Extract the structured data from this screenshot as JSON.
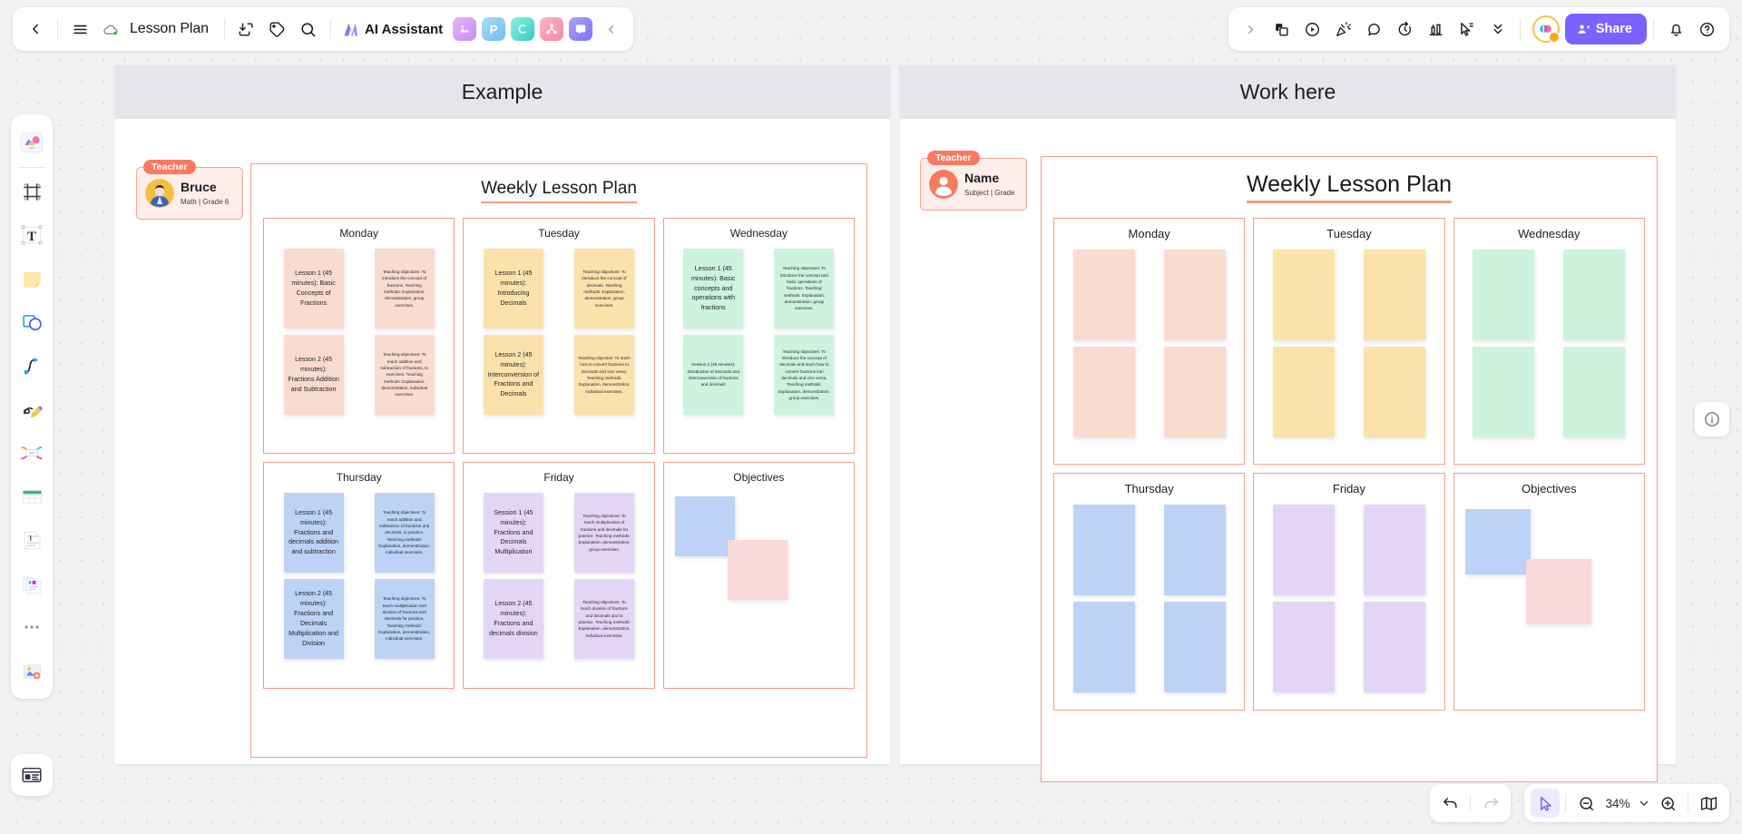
{
  "topbar": {
    "back_icon": "chevron-left-icon",
    "menu_icon": "hamburger-menu-icon",
    "cloud_icon": "cloud-sync-icon",
    "doc_title": "Lesson Plan",
    "download_icon": "download-icon",
    "tag_icon": "tag-icon",
    "search_icon": "search-icon",
    "ai_label": "AI Assistant",
    "apps": [
      {
        "name": "image-app",
        "glyph": "◩",
        "color": "#d6a6f5"
      },
      {
        "name": "presentation-app",
        "glyph": "P",
        "color": "#7fc4f5"
      },
      {
        "name": "mindmap-app",
        "glyph": "ᴄ",
        "color": "#3fd0c9"
      },
      {
        "name": "flowchart-app",
        "glyph": "Ѧ",
        "color": "#f58fae"
      },
      {
        "name": "comment-app",
        "glyph": "▣",
        "color": "#8e7bf7"
      }
    ],
    "collapse_icon": "chevron-left-icon",
    "expand_icon": "chevron-right-icon",
    "right_tools": [
      {
        "name": "sticky-note-icon"
      },
      {
        "name": "play-circle-icon"
      },
      {
        "name": "celebrate-icon"
      },
      {
        "name": "comment-bubble-icon"
      },
      {
        "name": "timer-icon"
      },
      {
        "name": "vote-chart-icon"
      },
      {
        "name": "cursor-select-icon"
      },
      {
        "name": "chevrons-down-icon"
      }
    ],
    "avatar_name": "user-avatar",
    "share_label": "Share",
    "bell_icon": "notification-bell-icon",
    "help_icon": "help-circle-icon"
  },
  "left_toolbar": {
    "items": [
      {
        "name": "templates-tool"
      },
      {
        "name": "frame-tool"
      },
      {
        "name": "text-tool"
      },
      {
        "name": "sticky-note-tool"
      },
      {
        "name": "shapes-tool"
      },
      {
        "name": "connector-tool"
      },
      {
        "name": "pen-tool"
      },
      {
        "name": "mindmap-tool"
      },
      {
        "name": "table-tool"
      },
      {
        "name": "document-tool"
      },
      {
        "name": "slides-tool"
      },
      {
        "name": "more-tools"
      },
      {
        "name": "upload-tool"
      }
    ],
    "bottom_tool": "presentation-mode-tool",
    "info_tool": "info-icon"
  },
  "bottombar": {
    "undo_icon": "undo-icon",
    "redo_icon": "redo-icon",
    "cursor_icon": "cursor-pointer-icon",
    "zoom_out_icon": "zoom-out-icon",
    "zoom_level": "34%",
    "zoom_dropdown_icon": "chevron-down-icon",
    "zoom_in_icon": "zoom-in-icon",
    "minimap_icon": "minimap-icon"
  },
  "boards": [
    {
      "name": "example-board",
      "header_title": "Example",
      "teacher": {
        "badge": "Teacher",
        "name": "Bruce",
        "subject": "Math | Grade 6"
      },
      "plan_title": "Weekly Lesson Plan",
      "days": [
        {
          "title": "Monday",
          "color": "#fadbd0",
          "notes": [
            {
              "type": "lesson",
              "text": "Lesson 1 (45 minutes): Basic Concepts of Fractions"
            },
            {
              "type": "detail",
              "text": "Teaching objectives: To introduce the concept of fractions. Teaching methods: Explanation, demonstration, group exercises."
            },
            {
              "type": "lesson",
              "text": "Lesson 2 (45 minutes): Fractions Addition and Subtraction"
            },
            {
              "type": "detail",
              "text": "Teaching objectives: To teach addition and subtraction of fractions, to exercises. Teaching methods: Explanation, demonstration, individual exercises."
            }
          ]
        },
        {
          "title": "Tuesday",
          "color": "#fbe2ab",
          "notes": [
            {
              "type": "lesson",
              "text": "Lesson 1 (45 minutes): Introducing Decimals"
            },
            {
              "type": "detail",
              "text": "Teaching objectives: To introduce the concept of decimals. Teaching methods: Explanation, demonstration, group exercises."
            },
            {
              "type": "lesson",
              "text": "Lesson 2 (45 minutes): Interconversion of Fractions and Decimals"
            },
            {
              "type": "detail",
              "text": "Teaching objective: To teach how to convert fractions to decimals and vice versa. Teaching methods: Explanation, demonstration, individual exercises."
            }
          ]
        },
        {
          "title": "Wednesday",
          "color": "#cdf2dd",
          "notes": [
            {
              "type": "lesson",
              "text": "Lesson 1 (45 minutes): Basic concepts and operations with fractions"
            },
            {
              "type": "detail",
              "text": "Teaching objectives: To introduce the concept and basic operations of fractions. Teaching methods: Explanation, demonstration, group exercises."
            },
            {
              "type": "detail",
              "text": "Session 2 (45 minutes): Introduction of decimals and interconversion of fractions and decimals"
            },
            {
              "type": "detail",
              "text": "Teaching objectives: To introduce the concept of decimals and teach how to convert fractions into decimals and vice versa. Teaching methods: Explanation, demonstration, group exercises."
            }
          ]
        },
        {
          "title": "Thursday",
          "color": "#bcd2f7",
          "notes": [
            {
              "type": "lesson",
              "text": "Lesson 1 (45 minutes): Fractions and decimals addition and subtraction"
            },
            {
              "type": "detail",
              "text": "Teaching objectives: To teach addition and subtraction of fractions and decimals, to practice. Teaching methods: Explanation, demonstration, individual exercises."
            },
            {
              "type": "lesson",
              "text": "Lesson 2 (45 minutes): Fractions and Decimals Multiplication and Division"
            },
            {
              "type": "detail",
              "text": "Teaching objectives: To teach multiplication and division of fractions and decimals for practice. Teaching methods: Explanation, demonstration, individual exercises."
            }
          ]
        },
        {
          "title": "Friday",
          "color": "#e4d5f7",
          "notes": [
            {
              "type": "lesson",
              "text": "Session 1 (45 minutes): Fractions and Decimals Multiplication"
            },
            {
              "type": "detail",
              "text": "Teaching objectives: To teach multiplication of fractions and decimals for practice. Teaching methods: Explanation, demonstration, group exercises."
            },
            {
              "type": "lesson",
              "text": "Lesson 2 (45 minutes): Fractions and decimals division"
            },
            {
              "type": "detail",
              "text": "Teaching objectives: To teach division of fractions and decimals and to practice. Teaching methods: Explanation, demonstration, individual exercises."
            }
          ]
        }
      ],
      "objectives": {
        "title": "Objectives",
        "notes": [
          {
            "color": "#bcd2f7"
          },
          {
            "color": "#fbdada"
          }
        ]
      }
    },
    {
      "name": "work-here-board",
      "header_title": "Work here",
      "teacher": {
        "badge": "Teacher",
        "name": "Name",
        "subject": "Subject | Grade"
      },
      "plan_title": "Weekly Lesson Plan",
      "days": [
        {
          "title": "Monday",
          "color": "#fadbd0",
          "notes": [
            {
              "type": "blank"
            },
            {
              "type": "blank"
            },
            {
              "type": "blank"
            },
            {
              "type": "blank"
            }
          ]
        },
        {
          "title": "Tuesday",
          "color": "#fbe2ab",
          "notes": [
            {
              "type": "blank"
            },
            {
              "type": "blank"
            },
            {
              "type": "blank"
            },
            {
              "type": "blank"
            }
          ]
        },
        {
          "title": "Wednesday",
          "color": "#cdf2dd",
          "notes": [
            {
              "type": "blank"
            },
            {
              "type": "blank"
            },
            {
              "type": "blank"
            },
            {
              "type": "blank"
            }
          ]
        },
        {
          "title": "Thursday",
          "color": "#bcd2f7",
          "notes": [
            {
              "type": "blank"
            },
            {
              "type": "blank"
            },
            {
              "type": "blank"
            },
            {
              "type": "blank"
            }
          ]
        },
        {
          "title": "Friday",
          "color": "#e4d5f7",
          "notes": [
            {
              "type": "blank"
            },
            {
              "type": "blank"
            },
            {
              "type": "blank"
            },
            {
              "type": "blank"
            }
          ]
        }
      ],
      "objectives": {
        "title": "Objectives",
        "notes": [
          {
            "color": "#bcd2f7"
          },
          {
            "color": "#fbdada"
          }
        ]
      }
    }
  ],
  "colors": {
    "accent": "#7b61ff",
    "board_border": "#f0a08c",
    "teacher_badge": "#f97a5f",
    "header_bg": "#e4e6ea"
  }
}
